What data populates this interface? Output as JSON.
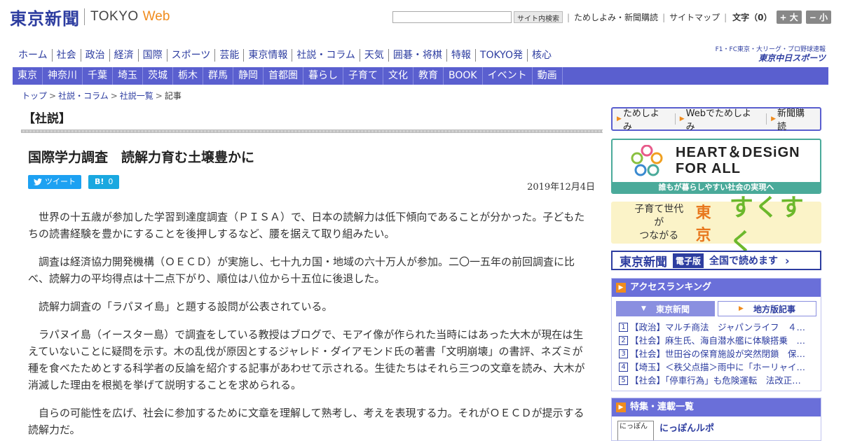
{
  "header": {
    "logo_jp": "東京新聞",
    "logo_en": "TOKYO",
    "logo_web": "Web",
    "search_button": "サイト内検索",
    "links": [
      "ためしよみ・新聞購読",
      "サイトマップ"
    ],
    "font_size_label": "文字（0）",
    "size_up": "+ 大",
    "size_down": "− 小"
  },
  "global_nav": [
    "ホーム",
    "社会",
    "政治",
    "経済",
    "国際",
    "スポーツ",
    "芸能",
    "東京情報",
    "社説・コラム",
    "天気",
    "囲碁・将棋",
    "特報",
    "TOKYO発",
    "核心"
  ],
  "chunichi": {
    "tagline": "F1・FC東京・大リーグ・プロ野球速報",
    "brand": "東京中日スポーツ"
  },
  "local_nav": [
    "東京",
    "神奈川",
    "千葉",
    "埼玉",
    "茨城",
    "栃木",
    "群馬",
    "静岡",
    "首都圏",
    "暮らし",
    "子育て",
    "文化",
    "教育",
    "BOOK",
    "イベント",
    "動画"
  ],
  "breadcrumb": [
    "トップ",
    "社説・コラム",
    "社説一覧",
    "記事"
  ],
  "article": {
    "section": "【社説】",
    "headline": "国際学力調査　読解力育む土壌豊かに",
    "tweet_label": "ツイート",
    "hatena_label": "B!",
    "hatena_count": "0",
    "date": "2019年12月4日",
    "paragraphs": [
      "世界の十五歳が参加した学習到達度調査（ＰＩＳＡ）で、日本の読解力は低下傾向であることが分かった。子どもたちの読書経験を豊かにすることを後押しするなど、腰を据えて取り組みたい。",
      "調査は経済協力開発機構（ＯＥＣＤ）が実施し、七十九カ国・地域の六十万人が参加。二〇一五年の前回調査に比べ、読解力の平均得点は十二点下がり、順位は八位から十五位に後退した。",
      "読解力調査の「ラパヌイ島」と題する設問が公表されている。",
      "ラパヌイ島（イースター島）で調査をしている教授はブログで、モアイ像が作られた当時にはあった大木が現在は生えていないことに疑問を示す。木の乱伐が原因とするジャレド・ダイアモンド氏の著書「文明崩壊」の書評、ネズミが種を食べたためとする科学者の反論を紹介する記事があわせて示される。生徒たちはそれら三つの文章を読み、大木が消滅した理由を根拠を挙げて説明することを求められる。",
      "自らの可能性を広げ、社会に参加するために文章を理解して熟考し、考えを表現する力。それがＯＥＣＤが提示する読解力だ。"
    ]
  },
  "sidebar": {
    "quick_links": [
      "ためしよみ",
      "Webでためしよみ",
      "新聞購読"
    ],
    "hd_banner_line1": "HEART＆DESiGN",
    "hd_banner_line2": "FOR ALL",
    "hd_banner_foot": "誰もが暮らしやすい社会の実現へ",
    "suku_sub1": "子育て世代が",
    "suku_sub2": "つながる",
    "suku_tokyo": "東京",
    "suku_main": "すくすく",
    "digi_logo": "東京新聞",
    "digi_badge": "電子版",
    "digi_text": "全国で読めます",
    "ranking_title": "アクセスランキング",
    "ranking_tabs": [
      "東京新聞",
      "地方版記事"
    ],
    "ranking": [
      {
        "num": "1",
        "title": "【政治】マルチ商法　ジャパンライフ　４…"
      },
      {
        "num": "2",
        "title": "【社会】麻生氏、海自潜水艦に体験搭乗　…"
      },
      {
        "num": "3",
        "title": "【社会】世田谷の保育施設が突然閉鎖　保…"
      },
      {
        "num": "4",
        "title": "【埼玉】＜秩父点描＞雨中に「ホーリャイ…"
      },
      {
        "num": "5",
        "title": "【社会】「停車行為」も危険運転　法改正…"
      }
    ],
    "features_title": "特集・連載一覧",
    "feature_thumb": "にっぽん",
    "feature_label": "にっぽんルポ"
  }
}
